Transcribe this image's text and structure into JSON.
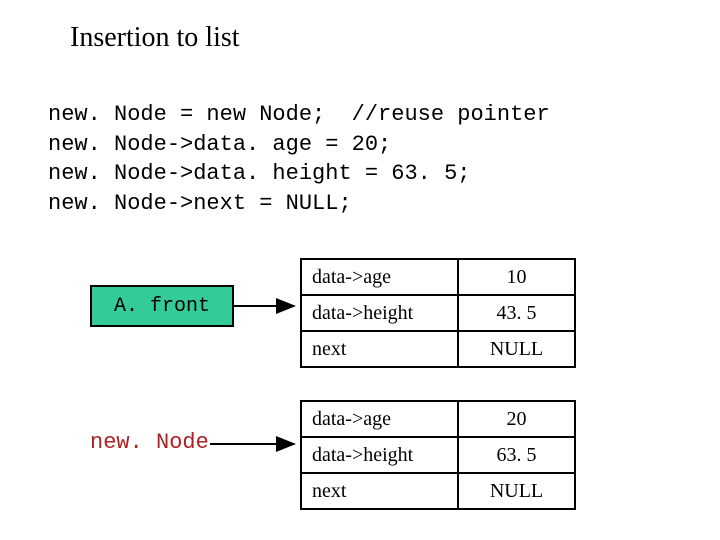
{
  "title": "Insertion to list",
  "code": {
    "l1": "new. Node = new Node;  //reuse pointer",
    "l2": "new. Node->data. age = 20;",
    "l3": "new. Node->data. height = 63. 5;",
    "l4": "new. Node->next = NULL;"
  },
  "labels": {
    "front": "A. front",
    "newNode": "new. Node"
  },
  "node1": {
    "age_k": "data->age",
    "age_v": "10",
    "height_k": "data->height",
    "height_v": "43. 5",
    "next_k": "next",
    "next_v": "NULL"
  },
  "node2": {
    "age_k": "data->age",
    "age_v": "20",
    "height_k": "data->height",
    "height_v": "63. 5",
    "next_k": "next",
    "next_v": "NULL"
  }
}
